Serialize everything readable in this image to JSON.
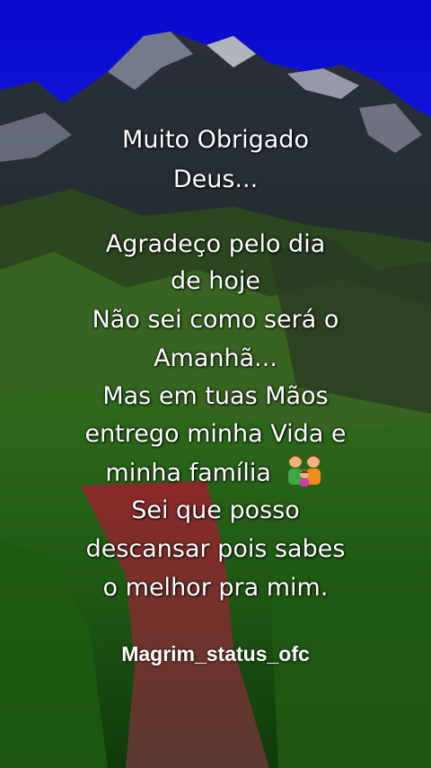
{
  "message": {
    "title_line1": "Muito Obrigado",
    "title_line2": "Deus...",
    "lines": [
      "Agradeço pelo dia",
      "de hoje",
      "Não sei como será o",
      "Amanhã...",
      "Mas em tuas Mãos",
      "entrego minha Vida e",
      "minha família",
      "Sei que posso",
      "descansar pois sabes",
      "o melhor pra mim."
    ],
    "family_emoji": "family-icon"
  },
  "signature": "Magrim_status_ofc",
  "colors": {
    "sky": "#1a1ae6",
    "text": "#ffffff"
  }
}
